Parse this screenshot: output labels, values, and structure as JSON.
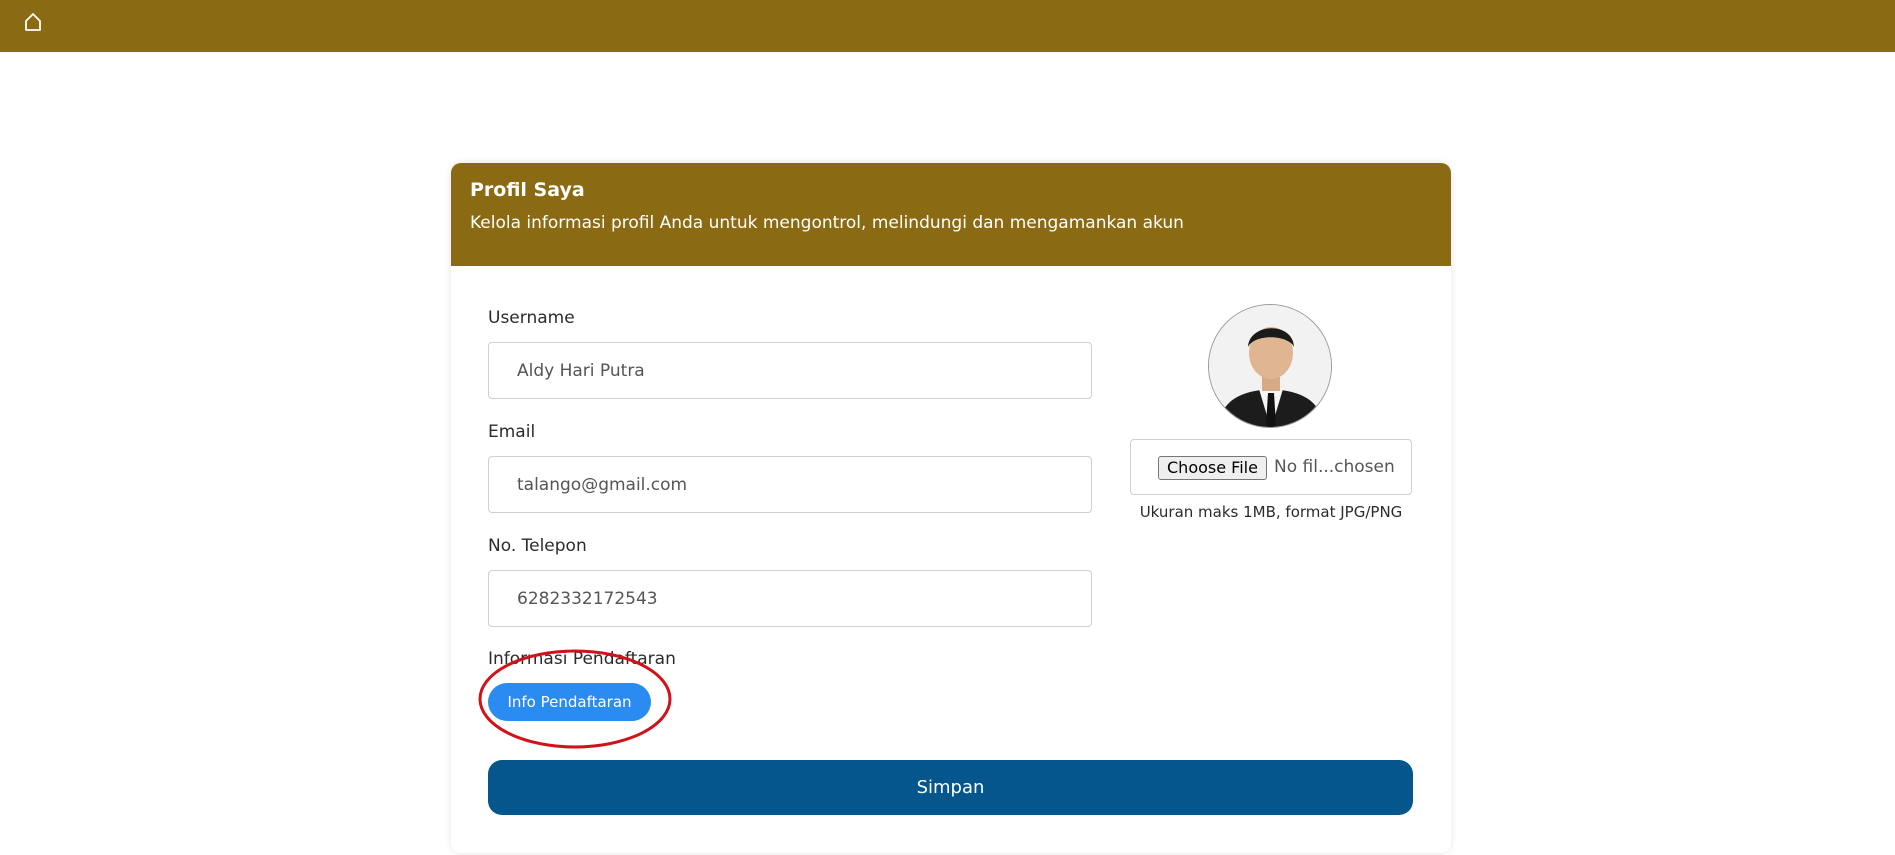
{
  "topbar": {
    "home_icon": "home-icon"
  },
  "profile": {
    "title": "Profil Saya",
    "subtitle": "Kelola informasi profil Anda untuk mengontrol, melindungi dan mengamankan akun"
  },
  "fields": {
    "username": {
      "label": "Username",
      "value": "Aldy Hari Putra"
    },
    "email": {
      "label": "Email",
      "value": "talango@gmail.com"
    },
    "phone": {
      "label": "No. Telepon",
      "value": "6282332172543"
    }
  },
  "photo": {
    "choose_file_label": "Choose File",
    "file_status": "No fil...chosen",
    "hint": "Ukuran maks 1MB, format JPG/PNG"
  },
  "registration": {
    "label": "Informasi Pendaftaran",
    "button_label": "Info Pendaftaran"
  },
  "actions": {
    "save_label": "Simpan"
  },
  "colors": {
    "brand": "#8a6a12",
    "primary_button": "#04568c",
    "info_button": "#2a8cf0",
    "annotation": "#d0121b"
  }
}
